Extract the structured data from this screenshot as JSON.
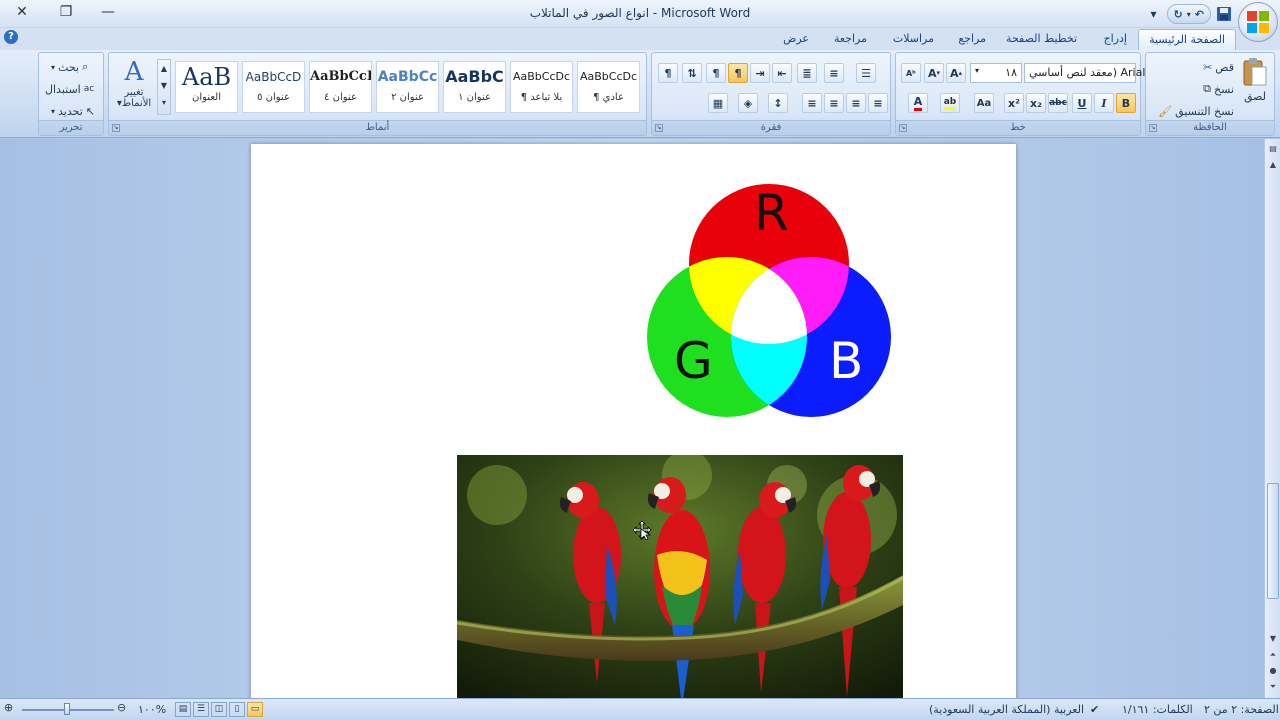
{
  "window": {
    "title": "انواع الصور في الماتلاب - Microsoft Word",
    "minimize_icon": "minimize-icon",
    "restore_icon": "restore-icon",
    "close_icon": "close-icon"
  },
  "tabs": [
    "الصفحة الرئيسية",
    "إدراج",
    "تخطيط الصفحة",
    "مراجع",
    "مراسلات",
    "مراجعة",
    "عرض"
  ],
  "active_tab": "الصفحة الرئيسية",
  "ribbon": {
    "clipboard": {
      "label": "الحافظة",
      "paste": "لصق",
      "cut": "قص",
      "copy": "نسخ",
      "format_painter": "نسخ التنسيق"
    },
    "font": {
      "label": "خط",
      "font_name": "معقد لنص أساسي) Arial",
      "font_size": "١٨"
    },
    "paragraph": {
      "label": "فقرة"
    },
    "styles": {
      "label": "أنماط",
      "items": [
        {
          "sample": "AaBbCcDc",
          "name": "¶ عادي"
        },
        {
          "sample": "AaBbCcDc",
          "name": "¶ بلا تباعد"
        },
        {
          "sample": "AaBbC",
          "name": "عنوان ١"
        },
        {
          "sample": "AaBbCc",
          "name": "عنوان ٢"
        },
        {
          "sample": "AaBbCcI",
          "name": "عنوان ٤"
        },
        {
          "sample": "AaBbCcD",
          "name": "عنوان ٥"
        },
        {
          "sample": "AaB",
          "name": "العنوان"
        }
      ],
      "change_styles_line1": "تغيير",
      "change_styles_line2": "الأنماط"
    },
    "editing": {
      "label": "تحرير",
      "find": "بحث",
      "replace": "استبدال",
      "select": "تحديد"
    }
  },
  "document": {
    "rgb_letters": {
      "r": "R",
      "g": "G",
      "b": "B"
    }
  },
  "status": {
    "page": "الصفحة: ٢ من ٢",
    "words": "الكلمات: ١/١٦١",
    "language": "العربية (المملكة العربية السعودية)",
    "zoom": "١٠٠%"
  },
  "colors": {
    "red": "#e8000b",
    "green": "#1ee01e",
    "blue": "#0b1cff",
    "yellow": "#ffff00",
    "magenta": "#ff1cf7",
    "cyan": "#00ffff",
    "white": "#ffffff"
  }
}
